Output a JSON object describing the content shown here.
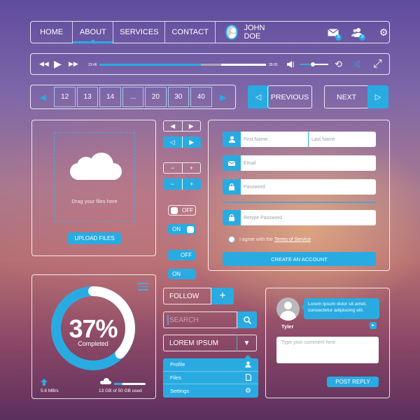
{
  "colors": {
    "accent": "#29abe2",
    "white": "#ffffff"
  },
  "nav": {
    "items": [
      {
        "label": "HOME",
        "active": false
      },
      {
        "label": "ABOUT",
        "active": true
      },
      {
        "label": "SERVICES",
        "active": false
      },
      {
        "label": "CONTACT",
        "active": false
      }
    ],
    "user_name": "JOHN DOE",
    "mail_badge": "5",
    "users_badge": "3",
    "icons": [
      "mail-icon",
      "users-icon",
      "gear-icon"
    ]
  },
  "player": {
    "elapsed": "23:46",
    "total": "35:05",
    "played_fraction": 0.61,
    "buffered_fraction": 0.73,
    "volume_fraction": 0.45,
    "shuffle_active": true,
    "icons": {
      "rewind": "⏪",
      "play": "▶",
      "forward": "⏩",
      "volume": "🔈",
      "repeat": "⟲",
      "shuffle": "⤨",
      "fullscreen": "⤢"
    }
  },
  "pagination": {
    "prev_icon": "◀",
    "next_icon": "▶",
    "pages": [
      "12",
      "13",
      "14",
      "...",
      "20",
      "30",
      "40"
    ]
  },
  "prev_next": {
    "previous": "PREVIOUS",
    "next": "NEXT",
    "prev_icon": "◁",
    "next_icon": "▷"
  },
  "upload": {
    "drop_text": "Drag your files here",
    "button": "UPLOAD FILES"
  },
  "steppers": {
    "arrow_left": "◀",
    "arrow_right": "▶",
    "arrow_left_outline": "◁",
    "minus": "−",
    "plus": "+"
  },
  "toggles": [
    {
      "label": "OFF",
      "state": "off",
      "style": "outline"
    },
    {
      "label": "ON",
      "state": "on",
      "style": "filled-knob"
    },
    {
      "label": "OFF",
      "state": "off",
      "style": "filled"
    },
    {
      "label": "ON",
      "state": "on",
      "style": "filled"
    }
  ],
  "signup": {
    "first_name_placeholder": "First Name",
    "last_name_placeholder": "Last Name",
    "email_placeholder": "Email",
    "password_placeholder": "Password",
    "retype_placeholder": "Retype Password",
    "agree_text": "I agree with the",
    "terms_link": "Terms of Service",
    "create_button": "CREATE AN ACCOUNT"
  },
  "progress": {
    "percent_value": 37,
    "percent_label": "37%",
    "caption": "Completed",
    "speed": "5.6 MB/s",
    "storage_used_gb": 13,
    "storage_total_gb": 50,
    "storage_text": "13 GB of 50 GB used"
  },
  "actions": {
    "follow": "FOLLOW",
    "follow_icon": "+",
    "search_placeholder": "SEARCH",
    "search_icon": "🔍",
    "dropdown_value": "LOREM IPSUM",
    "dropdown_icon": "▼"
  },
  "menu": {
    "items": [
      {
        "label": "Profile",
        "icon": "👤"
      },
      {
        "label": "Files",
        "icon": "🗋"
      },
      {
        "label": "Settings",
        "icon": "⚙"
      }
    ]
  },
  "comment": {
    "author": "Tyler",
    "message": "Lorem ipsum dolor sit amet, consectetur adipiscing elit.",
    "input_placeholder": "Type your comment here",
    "post_button": "POST REPLY",
    "play_icon": "▶"
  }
}
